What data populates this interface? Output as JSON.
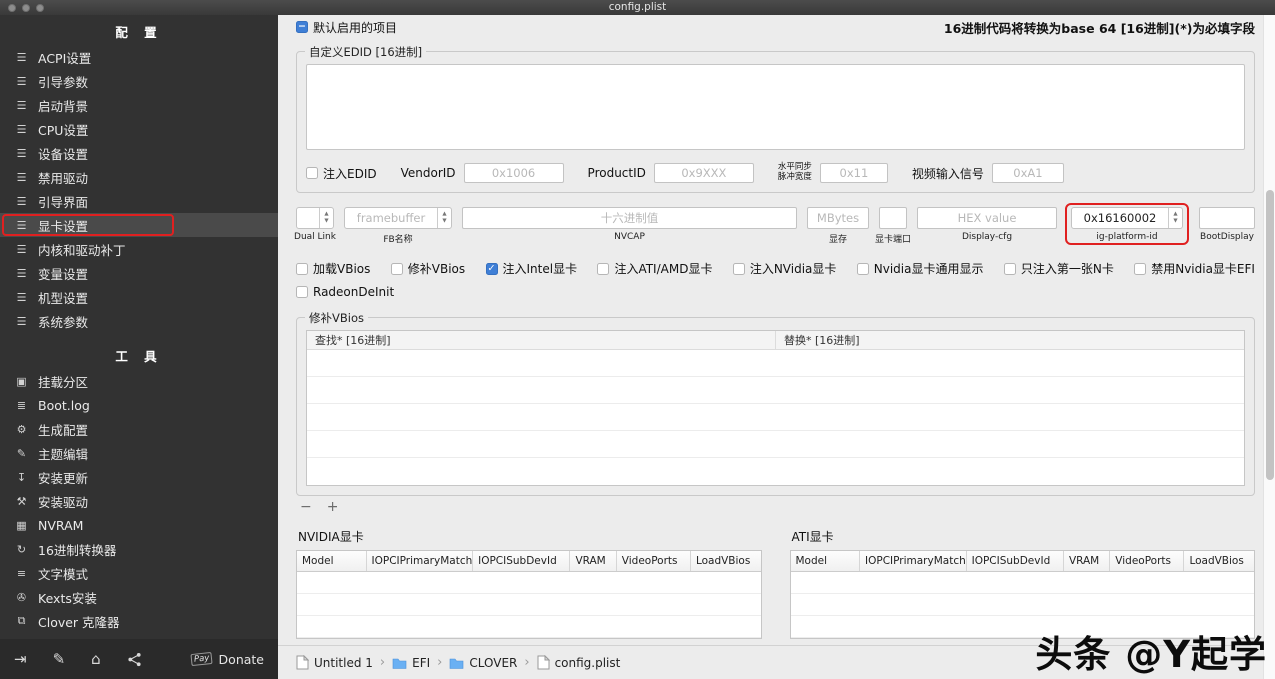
{
  "window": {
    "title": "config.plist"
  },
  "sidebar": {
    "config_header": "配  置",
    "tools_header": "工  具",
    "config_items": [
      "ACPI设置",
      "引导参数",
      "启动背景",
      "CPU设置",
      "设备设置",
      "禁用驱动",
      "引导界面",
      "显卡设置",
      "内核和驱动补丁",
      "变量设置",
      "机型设置",
      "系统参数"
    ],
    "tool_items": [
      "挂载分区",
      "Boot.log",
      "生成配置",
      "主题编辑",
      "安装更新",
      "安装驱动",
      "NVRAM",
      "16进制转换器",
      "文字模式",
      "Kexts安装",
      "Clover 克隆器"
    ],
    "selected_item": "显卡设置",
    "donate": {
      "pay": "Pay",
      "label": "Donate"
    }
  },
  "topbar": {
    "default_items_label": "默认启用的项目",
    "hex_note": "16进制代码将转换为base 64 [16进制](*)为必填字段"
  },
  "edid": {
    "group_title": "自定义EDID [16进制]",
    "inject_label": "注入EDID",
    "vendor_label": "VendorID",
    "vendor_placeholder": "0x1006",
    "product_label": "ProductID",
    "product_placeholder": "0x9XXX",
    "hsync_label_line1": "水平同步",
    "hsync_label_line2": "脉冲宽度",
    "hsync_placeholder": "0x11",
    "video_signal_label": "视频输入信号",
    "video_signal_placeholder": "0xA1"
  },
  "gpu_controls": {
    "dual_link": {
      "label": "Dual Link",
      "value": ""
    },
    "fb_name": {
      "label": "FB名称",
      "placeholder": "framebuffer"
    },
    "nvcap": {
      "label": "NVCAP",
      "placeholder": "十六进制值"
    },
    "vram": {
      "label": "显存",
      "placeholder": "MBytes"
    },
    "video_ports": {
      "label": "显卡端口",
      "value": ""
    },
    "display_cfg": {
      "label": "Display-cfg",
      "placeholder": "HEX value"
    },
    "ig_platform_id": {
      "label": "ig-platform-id",
      "value": "0x16160002"
    },
    "boot_display": {
      "label": "BootDisplay",
      "value": ""
    }
  },
  "gpu_flags": [
    "加载VBios",
    "修补VBios",
    "注入Intel显卡",
    "注入ATI/AMD显卡",
    "注入NVidia显卡",
    "Nvidia显卡通用显示",
    "只注入第一张N卡",
    "禁用Nvidia显卡EFI"
  ],
  "gpu_flags_checked": "注入Intel显卡",
  "radeon_deinit_label": "RadeonDeInit",
  "vbios_patch": {
    "group_title": "修补VBios",
    "find_column": "查找* [16进制]",
    "replace_column": "替换* [16进制]"
  },
  "nvidia_table": {
    "title": "NVIDIA显卡",
    "columns": [
      "Model",
      "IOPCIPrimaryMatch",
      "IOPCISubDevId",
      "VRAM",
      "VideoPorts",
      "LoadVBios"
    ]
  },
  "ati_table": {
    "title": "ATI显卡",
    "columns": [
      "Model",
      "IOPCIPrimaryMatch",
      "IOPCISubDevId",
      "VRAM",
      "VideoPorts",
      "LoadVBios"
    ]
  },
  "footer": {
    "breadcrumb": [
      "Untitled 1",
      "EFI",
      "CLOVER",
      "config.plist"
    ]
  },
  "watermark": "头条 @Y起学",
  "glyphs": {
    "check": "✓",
    "mixed": "−",
    "up": "▲",
    "down": "▼",
    "minus": "−",
    "plus": "+",
    "chevron": "›"
  },
  "icons": {
    "list": "☰",
    "mount": "▣",
    "log": "≣",
    "gear": "⚙",
    "pencil": "✎",
    "download": "↧",
    "hammer": "⚒",
    "chip": "▦",
    "refresh": "↻",
    "lines": "≡",
    "tape": "✇",
    "clone": "⧉",
    "exit": "⇥",
    "compose": "✎",
    "home": "⌂"
  },
  "colors": {
    "highlight_red": "#e02020",
    "folder_blue": "#6ab0f3",
    "checkbox_blue": "#3f7fd6"
  }
}
